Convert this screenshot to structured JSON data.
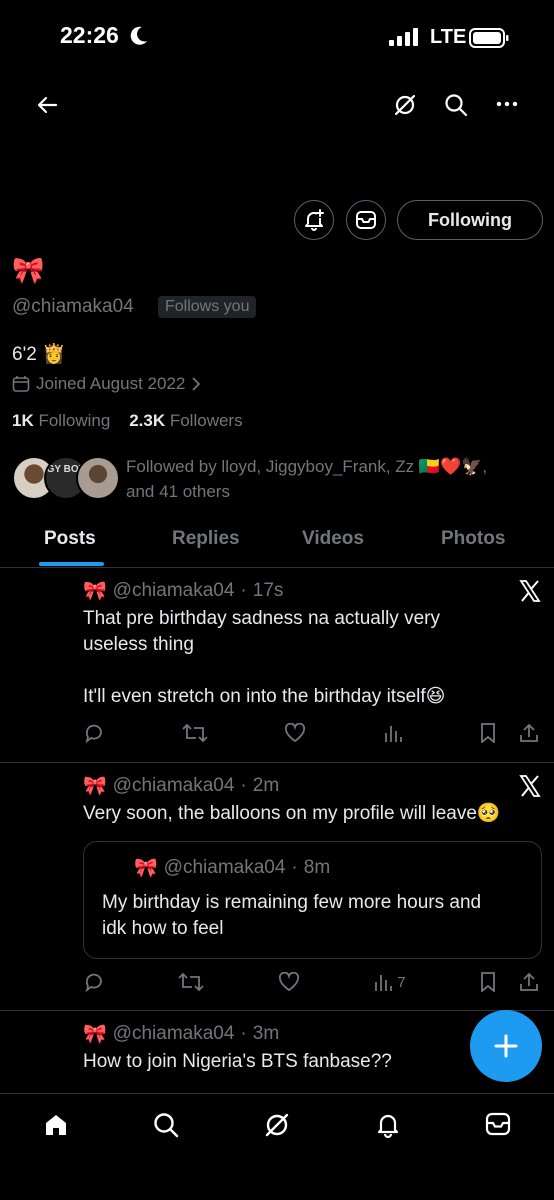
{
  "status_bar": {
    "time": "22:26",
    "network": "LTE"
  },
  "header": {
    "back_icon": "arrow-left-icon",
    "icons": [
      "grok-icon",
      "search-icon",
      "more-icon"
    ]
  },
  "profile": {
    "name_emoji": "🎀",
    "handle": "@chiamaka04",
    "follows_you": "Follows you",
    "follow_button": "Following",
    "bio": "6'2 👸",
    "joined": "Joined August 2022",
    "following_count": "1K",
    "following_label": "Following",
    "followers_count": "2.3K",
    "followers_label": "Followers",
    "followed_by": "Followed by lloyd, Jiggyboy_Frank, Zz 🇧🇯❤️🦅,",
    "followed_by_more": "and 41 others",
    "avatar_badge": "GY BOY"
  },
  "tabs": [
    "Posts",
    "Replies",
    "Videos",
    "Photos"
  ],
  "posts": [
    {
      "emoji": "🎀",
      "handle": "@chiamaka04",
      "time": "17s",
      "lines": [
        "That pre birthday sadness na actually very",
        "useless thing",
        "",
        "It'll even stretch on into the birthday itself😆"
      ]
    },
    {
      "emoji": "🎀",
      "handle": "@chiamaka04",
      "time": "2m",
      "lines": [
        "Very soon, the balloons on my profile will leave🥺"
      ],
      "quote": {
        "emoji": "🎀",
        "handle": "@chiamaka04",
        "time": "8m",
        "lines": [
          "My birthday is remaining few more hours and",
          "idk how to feel"
        ]
      },
      "views": "7"
    },
    {
      "emoji": "🎀",
      "handle": "@chiamaka04",
      "time": "3m",
      "lines": [
        "How to join Nigeria's BTS fanbase??"
      ]
    }
  ],
  "separator": "·",
  "colors": {
    "accent": "#1d9bf0",
    "background": "#000000",
    "muted": "#71767b"
  }
}
